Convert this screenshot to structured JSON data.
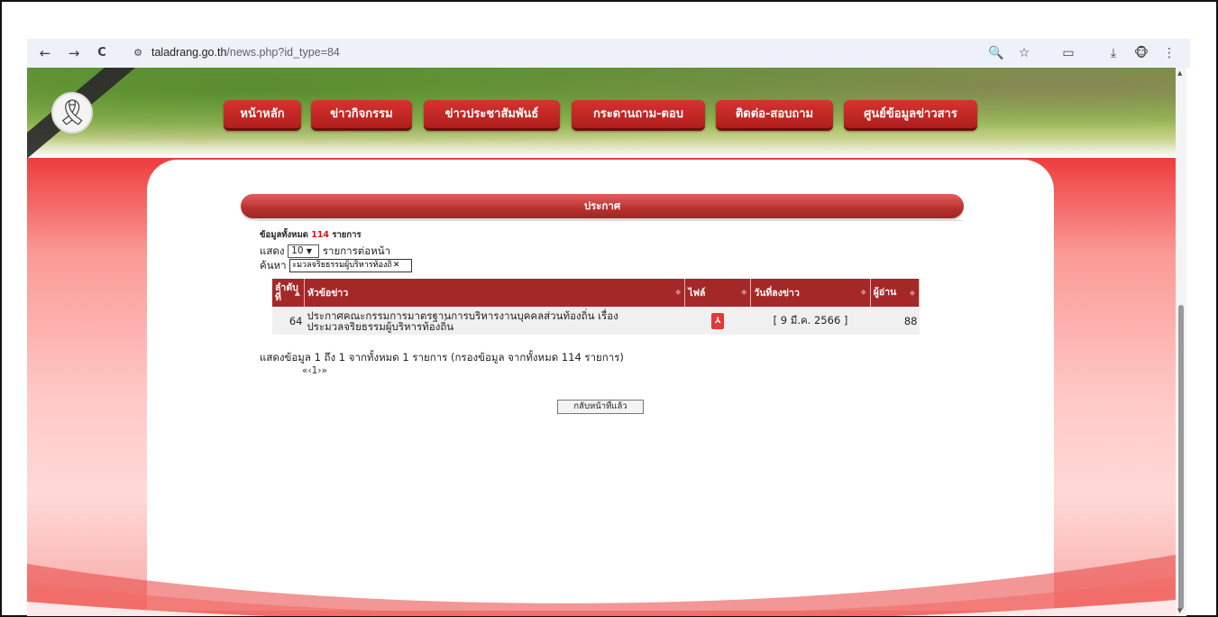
{
  "browser": {
    "url_host": "taladrang.go.th",
    "url_path": "/news.php?id_type=84",
    "back_glyph": "←",
    "forward_glyph": "→",
    "reload_glyph": "C",
    "site_info_glyph": "⚙",
    "zoom_glyph": "🔍",
    "star_glyph": "☆",
    "lens_glyph": "▭",
    "download_glyph": "⤓",
    "avatar_glyph": "🐵",
    "menu_glyph": "⋮"
  },
  "site": {
    "ribbon_glyph": "🎗",
    "menu": [
      "หน้าหลัก",
      "ข่าวกิจกรรม",
      "ข่าวประชาสัมพันธ์",
      "กระดานถาม-ตอบ",
      "ติดต่อ-สอบถาม",
      "ศูนย์ข้อมูลข่าวสาร"
    ]
  },
  "section": {
    "title": "ประกาศ"
  },
  "listing": {
    "total_prefix": "ข้อมูลทั้งหมด",
    "total_count": "114",
    "total_suffix": "รายการ",
    "show_label": "แสดง",
    "page_size": "10",
    "per_page_label": "รายการต่อหน้า",
    "search_label": "ค้นหา",
    "search_value": "ะมวลจริยธรรมผู้บริหารท้องถิ่",
    "search_clear": "✕"
  },
  "table": {
    "headers": [
      "ลำดับที่",
      "หัวข้อข่าว",
      "ไฟล์",
      "วันที่ลงข่าว",
      "ผู้อ่าน"
    ],
    "rows": [
      {
        "no": "64",
        "title_line1": "ประกาศคณะกรรมการมาตรฐานการบริหารงานบุคคลส่วนท้องถิ่น เรื่อง",
        "title_line2": "ประมวลจริยธรรมผู้บริหารท้องถิ่น",
        "file_icon": "pdf-icon",
        "date": "[ 9 มี.ค. 2566 ]",
        "readers": "88"
      }
    ]
  },
  "summary": "แสดงข้อมูล 1 ถึง 1 จากทั้งหมด 1 รายการ (กรองข้อมูล จากทั้งหมด 114 รายการ)",
  "pager": {
    "first": "«",
    "prev": "‹",
    "page": "1",
    "next": "›",
    "last": "»"
  },
  "back_button": "กลับหน้าที่แล้ว",
  "colors": {
    "brand_red": "#a52828",
    "menu_red": "#c52623",
    "count_red": "#dd1111"
  }
}
